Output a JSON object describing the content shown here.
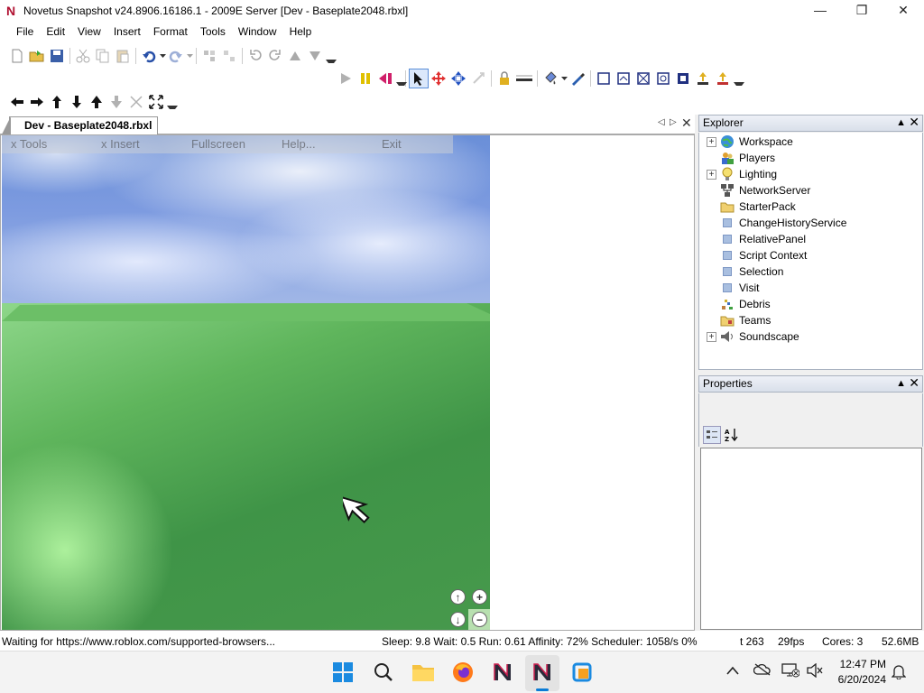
{
  "window": {
    "title": "Novetus Snapshot v24.8906.16186.1 - 2009E Server [Dev - Baseplate2048.rbxl]",
    "logo_icon": "novetus-logo-icon",
    "minimize_glyph": "—",
    "maximize_glyph": "❐",
    "close_glyph": "✕"
  },
  "menu": [
    "File",
    "Edit",
    "View",
    "Insert",
    "Format",
    "Tools",
    "Window",
    "Help"
  ],
  "document_tab": {
    "label": "Dev - Baseplate2048.rbxl"
  },
  "viewport_overlay": {
    "tools": "x Tools",
    "insert": "x Insert",
    "fullscreen": "Fullscreen",
    "help": "Help...",
    "exit": "Exit"
  },
  "explorer": {
    "title": "Explorer",
    "items": [
      {
        "label": "Workspace",
        "expandable": true,
        "icon": "globe-icon"
      },
      {
        "label": "Players",
        "expandable": false,
        "icon": "players-icon"
      },
      {
        "label": "Lighting",
        "expandable": true,
        "icon": "lightbulb-icon"
      },
      {
        "label": "NetworkServer",
        "expandable": false,
        "icon": "network-icon"
      },
      {
        "label": "StarterPack",
        "expandable": false,
        "icon": "folder-icon"
      },
      {
        "label": "ChangeHistoryService",
        "expandable": false,
        "icon": "service-icon"
      },
      {
        "label": "RelativePanel",
        "expandable": false,
        "icon": "service-icon"
      },
      {
        "label": "Script Context",
        "expandable": false,
        "icon": "service-icon"
      },
      {
        "label": "Selection",
        "expandable": false,
        "icon": "service-icon"
      },
      {
        "label": "Visit",
        "expandable": false,
        "icon": "service-icon"
      },
      {
        "label": "Debris",
        "expandable": false,
        "icon": "debris-icon"
      },
      {
        "label": "Teams",
        "expandable": false,
        "icon": "teams-folder-icon"
      },
      {
        "label": "Soundscape",
        "expandable": true,
        "icon": "speaker-icon"
      }
    ]
  },
  "properties": {
    "title": "Properties",
    "categorized_icon": "categorized-icon",
    "alphabetical_icon": "alphabetical-sort-icon"
  },
  "statusbar": {
    "message": "Waiting for https://www.roblox.com/supported-browsers...",
    "stats": "Sleep: 9.8 Wait: 0.5 Run: 0.61 Affinity: 72% Scheduler: 1058/s 0%",
    "t": "t 263",
    "fps": "29fps",
    "cores": "Cores: 3",
    "memory": "52.6MB"
  },
  "taskbar": {
    "time": "12:47 PM",
    "date": "6/20/2024",
    "apps": [
      "windows-start-icon",
      "search-icon",
      "file-explorer-icon",
      "firefox-icon",
      "novetus-icon",
      "novetus-studio-icon",
      "virtualbox-icon"
    ]
  },
  "colors": {
    "sky": "#7d9be0",
    "ground": "#4a9e4e",
    "accent": "#0a7cd6"
  }
}
